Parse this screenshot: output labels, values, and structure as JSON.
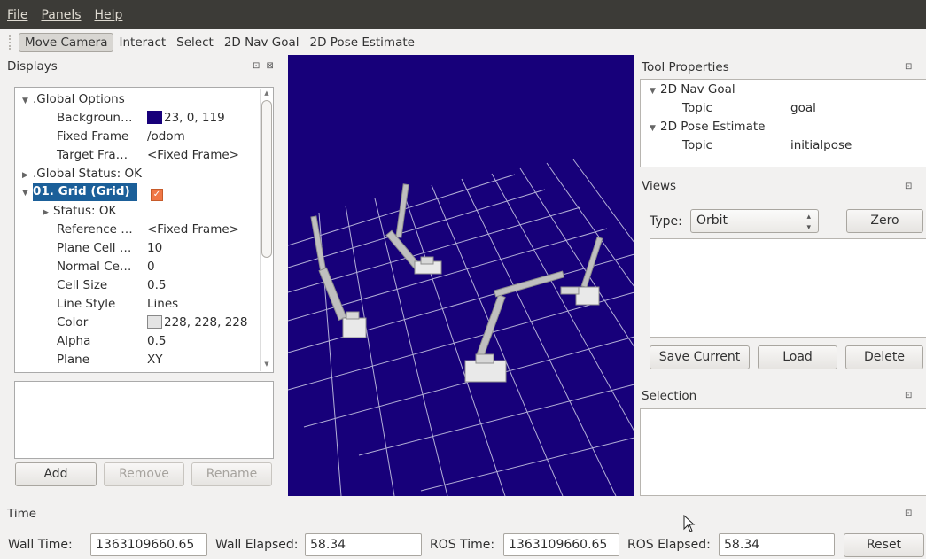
{
  "menu": [
    "File",
    "Panels",
    "Help"
  ],
  "toolbar": {
    "tools": [
      "Move Camera",
      "Interact",
      "Select",
      "2D Nav Goal",
      "2D Pose Estimate"
    ],
    "active": "Move Camera"
  },
  "displays": {
    "title": "Displays",
    "dock_icons": "⊡ ⊠",
    "tree": {
      "global_options": ".Global Options",
      "background_label": "Backgroun…",
      "background_value": "23, 0, 119",
      "background_color": "#17007a",
      "fixed_frame_label": "Fixed Frame",
      "fixed_frame_value": "/odom",
      "target_frame_label": "Target Fra…",
      "target_frame_value": "<Fixed Frame>",
      "global_status": ".Global Status: OK",
      "grid_label": "01. Grid (Grid)",
      "status": "Status: OK",
      "reference_label": "Reference …",
      "reference_value": "<Fixed Frame>",
      "plane_cell_label": "Plane Cell …",
      "plane_cell_value": "10",
      "normal_cell_label": "Normal Ce…",
      "normal_cell_value": "0",
      "cell_size_label": "Cell Size",
      "cell_size_value": "0.5",
      "line_style_label": "Line Style",
      "line_style_value": "Lines",
      "color_label": "Color",
      "color_value": "228, 228, 228",
      "grid_color": "#e4e4e4",
      "alpha_label": "Alpha",
      "alpha_value": "0.5",
      "plane_label": "Plane",
      "plane_value": "XY"
    },
    "buttons": {
      "add": "Add",
      "remove": "Remove",
      "rename": "Rename"
    }
  },
  "tool_properties": {
    "title": "Tool Properties",
    "nav_goal": "2D Nav Goal",
    "nav_goal_topic_label": "Topic",
    "nav_goal_topic_value": "goal",
    "pose_estimate": "2D Pose Estimate",
    "pose_topic_label": "Topic",
    "pose_topic_value": "initialpose"
  },
  "views": {
    "title": "Views",
    "type_label": "Type:",
    "type_value": "Orbit",
    "zero": "Zero",
    "save_current": "Save Current",
    "load": "Load",
    "delete": "Delete"
  },
  "selection": {
    "title": "Selection"
  },
  "time": {
    "title": "Time",
    "wall_time_label": "Wall Time:",
    "wall_time_value": "1363109660.65",
    "wall_elapsed_label": "Wall Elapsed:",
    "wall_elapsed_value": "58.34",
    "ros_time_label": "ROS Time:",
    "ros_time_value": "1363109660.65",
    "ros_elapsed_label": "ROS Elapsed:",
    "ros_elapsed_value": "58.34",
    "reset": "Reset"
  }
}
